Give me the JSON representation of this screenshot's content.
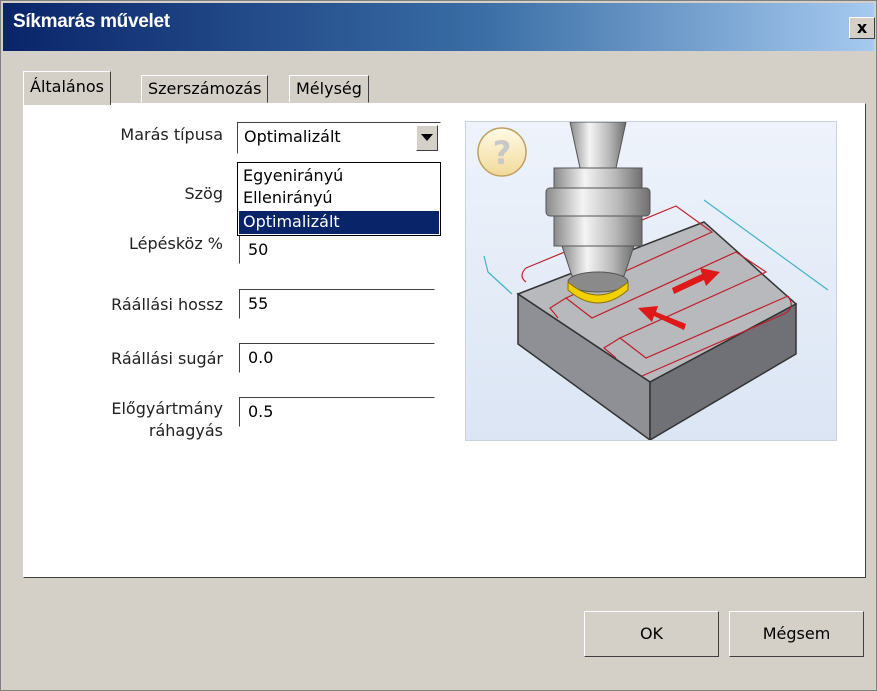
{
  "window": {
    "title": "Síkmarás művelet",
    "close_label": "x"
  },
  "tabs": [
    {
      "label": "Általános"
    },
    {
      "label": "Szerszámozás"
    },
    {
      "label": "Mélység"
    }
  ],
  "form": {
    "milling_type": {
      "label": "Marás típusa",
      "value": "Optimalizált",
      "options": [
        "Egyenirányú",
        "Ellenirányú",
        "Optimalizált"
      ]
    },
    "angle": {
      "label": "Szög"
    },
    "stepover": {
      "label": "Lépésköz %",
      "value": "50"
    },
    "lead_in_length": {
      "label": "Ráállási hossz",
      "value": "55"
    },
    "lead_in_radius": {
      "label": "Ráállási sugár",
      "value": "0.0"
    },
    "stock_allowance": {
      "label_line1": "Előgyártmány",
      "label_line2": "ráhagyás",
      "value": "0.5"
    }
  },
  "buttons": {
    "ok": "OK",
    "cancel": "Mégsem"
  },
  "colors": {
    "titlebar_start": "#0a246a",
    "titlebar_end": "#a6caf0",
    "selection": "#0a246a",
    "face": "#d4d0c8"
  },
  "icons": {
    "help": "question-mark-icon",
    "dropdown": "triangle-down-icon",
    "close": "close-icon"
  }
}
